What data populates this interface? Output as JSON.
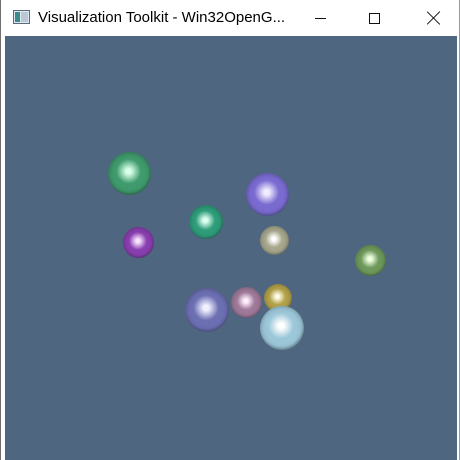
{
  "window": {
    "title": "Visualization Toolkit - Win32OpenG...",
    "app_icon": "vtk-window-icon",
    "controls": [
      "minimize-icon",
      "maximize-icon",
      "close-icon"
    ]
  },
  "viewport": {
    "background": "#4e6680",
    "spheres": [
      {
        "color": "#3f9a6c",
        "glow": "#d8ffe8"
      },
      {
        "color": "#7a6bd0",
        "glow": "#f2ecff"
      },
      {
        "color": "#2f9d7a",
        "glow": "#dcfff0"
      },
      {
        "color": "#8a3fb0",
        "glow": "#f6e2ff"
      },
      {
        "color": "#a8a88e",
        "glow": "#ffffff"
      },
      {
        "color": "#6f9a5c",
        "glow": "#f0ffe0"
      },
      {
        "color": "#6c6fb2",
        "glow": "#f0f0ff"
      },
      {
        "color": "#a07a9a",
        "glow": "#ffeefe"
      },
      {
        "color": "#b3a24a",
        "glow": "#fffbe6"
      },
      {
        "color": "#9cc7d9",
        "glow": "#ffffff"
      }
    ]
  }
}
